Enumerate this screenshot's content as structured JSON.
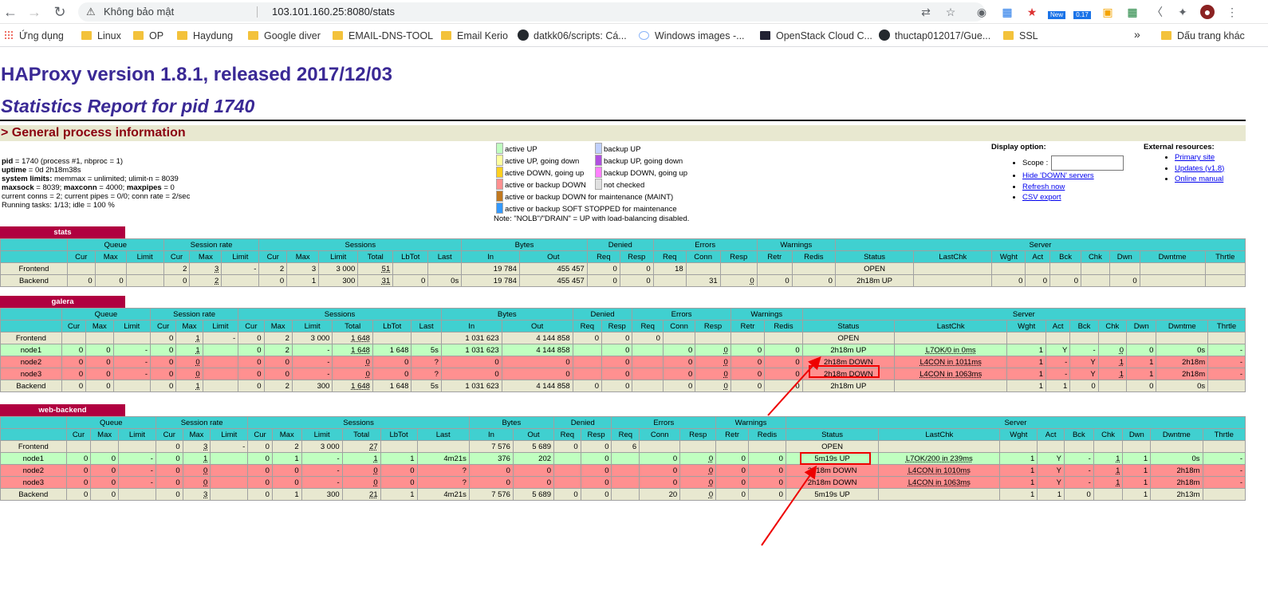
{
  "browser": {
    "back_icon": "arrow-left-icon",
    "forward_icon": "arrow-right-icon",
    "reload_icon": "reload-icon",
    "security_label": "Không bảo mật",
    "url": "103.101.160.25:8080/stats",
    "ext_badge_new": "New",
    "ext_badge_017": "0.17"
  },
  "bookmarks": {
    "apps": "Ứng dụng",
    "items": [
      "Linux",
      "OP",
      "Haydung",
      "Google diver",
      "EMAIL-DNS-TOOL",
      "Email Kerio",
      "datkk06/scripts: Cá...",
      "Windows images -...",
      "OpenStack Cloud C...",
      "thuctap012017/Gue...",
      "SSL"
    ],
    "more": "»",
    "other": "Dấu trang khác"
  },
  "page": {
    "title": "HAProxy version 1.8.1, released 2017/12/03",
    "subtitle": "Statistics Report for pid 1740",
    "section": "> General process information"
  },
  "process_info": [
    [
      "pid",
      " = 1740 (process #1, nbproc = 1)"
    ],
    [
      "uptime",
      " = 0d 2h18m38s"
    ],
    [
      "system limits:",
      " memmax = unlimited; ulimit-n = 8039"
    ],
    [
      "maxsock",
      " = 8039; ",
      "maxconn",
      " = 4000; ",
      "maxpipes",
      " = 0"
    ],
    [
      "",
      "current conns = 2; current pipes = 0/0; conn rate = 2/sec"
    ],
    [
      "",
      "Running tasks: 1/13; idle = 100 %"
    ]
  ],
  "legend": {
    "left": [
      {
        "label": "active UP",
        "color": "#c0ffc0"
      },
      {
        "label": "active UP, going down",
        "color": "#ffffa0"
      },
      {
        "label": "active DOWN, going up",
        "color": "#ffd020"
      },
      {
        "label": "active or backup DOWN",
        "color": "#ff9090"
      },
      {
        "label": "active or backup DOWN for maintenance (MAINT)",
        "color": "#c07820"
      },
      {
        "label": "active or backup SOFT STOPPED for maintenance",
        "color": "#3399ff"
      }
    ],
    "right": [
      {
        "label": "backup UP",
        "color": "#c0d0ff"
      },
      {
        "label": "backup UP, going down",
        "color": "#b050e0"
      },
      {
        "label": "backup DOWN, going up",
        "color": "#ff80ff"
      },
      {
        "label": "not checked",
        "color": "#e0e0e0"
      }
    ],
    "note": "Note: \"NOLB\"/\"DRAIN\" = UP with load-balancing disabled."
  },
  "display_option": {
    "title": "Display option:",
    "scope_label": "Scope :",
    "links": [
      "Hide 'DOWN' servers",
      "Refresh now",
      "CSV export"
    ]
  },
  "external": {
    "title": "External resources:",
    "links": [
      "Primary site",
      "Updates (v1.8)",
      "Online manual"
    ]
  },
  "group_headers": [
    "Queue",
    "Session rate",
    "Sessions",
    "Bytes",
    "Denied",
    "Errors",
    "Warnings",
    "Server"
  ],
  "col_headers": [
    "Cur",
    "Max",
    "Limit",
    "Cur",
    "Max",
    "Limit",
    "Cur",
    "Max",
    "Limit",
    "Total",
    "LbTot",
    "Last",
    "In",
    "Out",
    "Req",
    "Resp",
    "Req",
    "Conn",
    "Resp",
    "Retr",
    "Redis",
    "Status",
    "LastChk",
    "Wght",
    "Act",
    "Bck",
    "Chk",
    "Dwn",
    "Dwntme",
    "Thrtle"
  ],
  "proxies": [
    {
      "name": "stats",
      "rows": [
        {
          "type": "fe",
          "cells": [
            "Frontend",
            "",
            "",
            "",
            "2",
            "3",
            "-",
            "2",
            "3",
            "3 000",
            "51",
            "",
            "",
            "19 784",
            "455 457",
            "0",
            "0",
            "18",
            "",
            "",
            "",
            "",
            "OPEN",
            "",
            "",
            "",
            "",
            "",
            "",
            "",
            ""
          ]
        },
        {
          "type": "be",
          "cells": [
            "Backend",
            "0",
            "0",
            "",
            "0",
            "2",
            "",
            "0",
            "1",
            "300",
            "31",
            "0",
            "0s",
            "19 784",
            "455 457",
            "0",
            "0",
            "",
            "31",
            "0",
            "0",
            "0",
            "2h18m UP",
            "",
            "0",
            "0",
            "0",
            "",
            "0",
            "",
            ""
          ]
        }
      ]
    },
    {
      "name": "galera",
      "rows": [
        {
          "type": "fe",
          "cells": [
            "Frontend",
            "",
            "",
            "",
            "0",
            "1",
            "-",
            "0",
            "2",
            "3 000",
            "1 648",
            "",
            "",
            "1 031 623",
            "4 144 858",
            "0",
            "0",
            "0",
            "",
            "",
            "",
            "",
            "OPEN",
            "",
            "",
            "",
            "",
            "",
            "",
            "",
            ""
          ]
        },
        {
          "type": "up",
          "cells": [
            "node1",
            "0",
            "0",
            "-",
            "0",
            "1",
            "",
            "0",
            "2",
            "-",
            "1 648",
            "1 648",
            "5s",
            "1 031 623",
            "4 144 858",
            "",
            "0",
            "",
            "0",
            "0",
            "0",
            "0",
            "2h18m UP",
            "L7OK/0 in 0ms",
            "1",
            "Y",
            "-",
            "0",
            "0",
            "0s",
            "-"
          ]
        },
        {
          "type": "down",
          "cells": [
            "node2",
            "0",
            "0",
            "-",
            "0",
            "0",
            "",
            "0",
            "0",
            "-",
            "0",
            "0",
            "?",
            "0",
            "0",
            "",
            "0",
            "",
            "0",
            "0",
            "0",
            "0",
            "2h18m DOWN",
            "L4CON in 1011ms",
            "1",
            "-",
            "Y",
            "1",
            "1",
            "2h18m",
            "-"
          ]
        },
        {
          "type": "down",
          "cells": [
            "node3",
            "0",
            "0",
            "-",
            "0",
            "0",
            "",
            "0",
            "0",
            "-",
            "0",
            "0",
            "?",
            "0",
            "0",
            "",
            "0",
            "",
            "0",
            "0",
            "0",
            "0",
            "2h18m DOWN",
            "L4CON in 1063ms",
            "1",
            "-",
            "Y",
            "1",
            "1",
            "2h18m",
            "-"
          ]
        },
        {
          "type": "be",
          "cells": [
            "Backend",
            "0",
            "0",
            "",
            "0",
            "1",
            "",
            "0",
            "2",
            "300",
            "1 648",
            "1 648",
            "5s",
            "1 031 623",
            "4 144 858",
            "0",
            "0",
            "",
            "0",
            "0",
            "0",
            "0",
            "2h18m UP",
            "",
            "1",
            "1",
            "0",
            "",
            "0",
            "0s",
            ""
          ]
        }
      ]
    },
    {
      "name": "web-backend",
      "rows": [
        {
          "type": "fe",
          "cells": [
            "Frontend",
            "",
            "",
            "",
            "0",
            "3",
            "-",
            "0",
            "2",
            "3 000",
            "27",
            "",
            "",
            "7 576",
            "5 689",
            "0",
            "0",
            "6",
            "",
            "",
            "",
            "",
            "OPEN",
            "",
            "",
            "",
            "",
            "",
            "",
            "",
            ""
          ]
        },
        {
          "type": "up",
          "cells": [
            "node1",
            "0",
            "0",
            "-",
            "0",
            "1",
            "",
            "0",
            "1",
            "-",
            "1",
            "1",
            "4m21s",
            "376",
            "202",
            "",
            "0",
            "",
            "0",
            "0",
            "0",
            "0",
            "5m19s UP",
            "L7OK/200 in 239ms",
            "1",
            "Y",
            "-",
            "1",
            "1",
            "0s",
            "-"
          ]
        },
        {
          "type": "down",
          "cells": [
            "node2",
            "0",
            "0",
            "-",
            "0",
            "0",
            "",
            "0",
            "0",
            "-",
            "0",
            "0",
            "?",
            "0",
            "0",
            "",
            "0",
            "",
            "0",
            "0",
            "0",
            "0",
            "2h18m DOWN",
            "L4CON in 1010ms",
            "1",
            "Y",
            "-",
            "1",
            "1",
            "2h18m",
            "-"
          ]
        },
        {
          "type": "down",
          "cells": [
            "node3",
            "0",
            "0",
            "-",
            "0",
            "0",
            "",
            "0",
            "0",
            "-",
            "0",
            "0",
            "?",
            "0",
            "0",
            "",
            "0",
            "",
            "0",
            "0",
            "0",
            "0",
            "2h18m DOWN",
            "L4CON in 1063ms",
            "1",
            "Y",
            "-",
            "1",
            "1",
            "2h18m",
            "-"
          ]
        },
        {
          "type": "be",
          "cells": [
            "Backend",
            "0",
            "0",
            "",
            "0",
            "3",
            "",
            "0",
            "1",
            "300",
            "21",
            "1",
            "4m21s",
            "7 576",
            "5 689",
            "0",
            "0",
            "",
            "20",
            "0",
            "0",
            "0",
            "5m19s UP",
            "",
            "1",
            "1",
            "0",
            "",
            "1",
            "2h13m",
            ""
          ]
        }
      ]
    }
  ]
}
